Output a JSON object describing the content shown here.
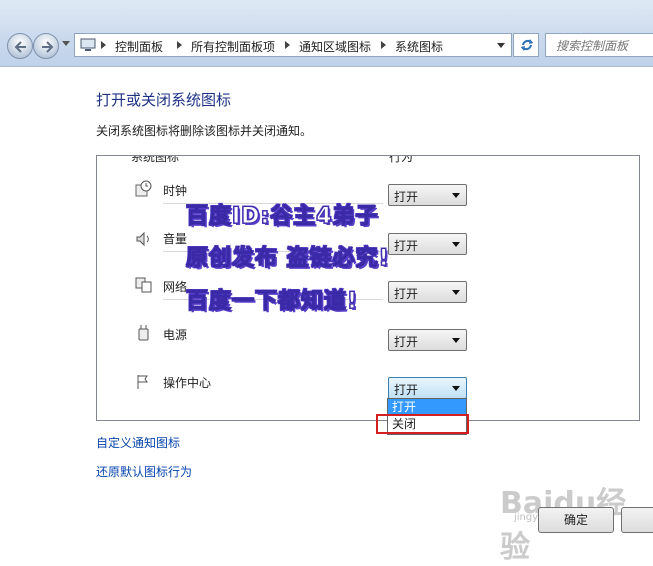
{
  "breadcrumb": {
    "items": [
      "控制面板",
      "所有控制面板项",
      "通知区域图标",
      "系统图标"
    ]
  },
  "search": {
    "placeholder": "搜索控制面板"
  },
  "page": {
    "title": "打开或关闭系统图标",
    "description": "关闭系统图标将删除该图标并关闭通知。"
  },
  "table": {
    "headers": {
      "icon": "系统图标",
      "behavior": "行为"
    },
    "rows": [
      {
        "label": "时钟",
        "icon": "clock-icon",
        "value": "打开"
      },
      {
        "label": "音量",
        "icon": "volume-icon",
        "value": "打开"
      },
      {
        "label": "网络",
        "icon": "network-icon",
        "value": "打开"
      },
      {
        "label": "电源",
        "icon": "power-icon",
        "value": "打开"
      },
      {
        "label": "操作中心",
        "icon": "flag-icon",
        "value": "打开"
      }
    ]
  },
  "dropdown": {
    "options": [
      "打开",
      "关闭"
    ],
    "highlighted": "打开",
    "annotated": "关闭"
  },
  "links": {
    "customize": "自定义通知图标",
    "restore": "还原默认图标行为"
  },
  "buttons": {
    "ok": "确定"
  },
  "watermark": {
    "lines": [
      "百度ID:谷主4弟子",
      "原创发布 盗链必究!",
      "百度一下都知道!"
    ],
    "logo_text": "Baidu经验",
    "logo_sub": "jingyan.baidu.com"
  },
  "colors": {
    "title": "#1e3287",
    "link": "#0645ad",
    "selected": "#3399ff",
    "annotation": "#d41f1f"
  }
}
